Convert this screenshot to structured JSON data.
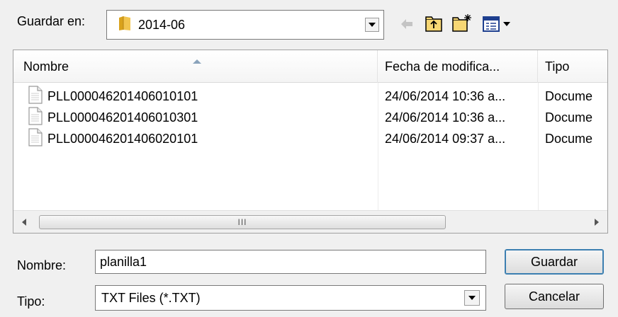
{
  "save_in": {
    "label": "Guardar en:",
    "folder": "2014-06",
    "folder_icon": "folder-icon"
  },
  "toolbar": {
    "back_icon": "back-arrow-icon",
    "up_icon": "up-folder-icon",
    "new_folder_icon": "new-folder-icon",
    "view_icon": "view-menu-icon"
  },
  "list": {
    "columns": {
      "name": "Nombre",
      "date": "Fecha de modifica...",
      "type": "Tipo"
    },
    "rows": [
      {
        "name": "PLL000046201406010101",
        "date": "24/06/2014 10:36 a...",
        "type": "Docume"
      },
      {
        "name": "PLL000046201406010301",
        "date": "24/06/2014 10:36 a...",
        "type": "Docume"
      },
      {
        "name": "PLL000046201406020101",
        "date": "24/06/2014 09:37 a...",
        "type": "Docume"
      }
    ],
    "scroll_grip": "III"
  },
  "filename": {
    "label": "Nombre:",
    "value": "planilla1"
  },
  "filetype": {
    "label": "Tipo:",
    "value": "TXT Files (*.TXT)"
  },
  "buttons": {
    "save": "Guardar",
    "cancel": "Cancelar"
  },
  "colors": {
    "folder": "#e8b73f",
    "accent": "#3c7fb1"
  }
}
